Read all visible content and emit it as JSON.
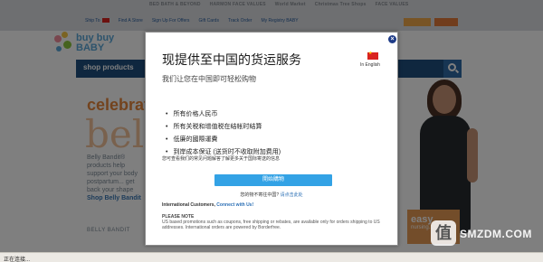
{
  "background_site": {
    "topbar_links": [
      "Ship To",
      "Find A Store",
      "Sign Up For Offers",
      "Gift Cards",
      "Track Order",
      "My Registry BABY"
    ],
    "brand_logos": [
      "BED BATH & BEYOND",
      "HARMON FACE VALUES",
      "World Market",
      "Christmas Tree Shops",
      "FACE VALUES"
    ],
    "logo": "buy buy BABY",
    "nav_label": "shop products",
    "hero_title": "celebrat",
    "hero_big": "bell",
    "hero_text": "Belly Bandit® products help support your body postpartum... get back your shape",
    "hero_link": "Shop Belly Bandit",
    "hero_brand": "BELLY BANDIT",
    "badge_big": "easy",
    "badge_small": "nursing..."
  },
  "modal": {
    "title": "现提供至中国的货运服务",
    "subtitle": "我们让您在中国即可轻松购物",
    "language": {
      "label": "In English",
      "flag_color": "#d9231f"
    },
    "benefits": [
      "所有价格人民币",
      "所有关税和增值税在结帐时结算",
      "低廉的國際運費",
      "到岸成本保证 (送货时不收取附加费用)"
    ],
    "info_line": "您可查看我们的常见问题解答了解更多关于国际寄送的信息",
    "start_button": "開始購物",
    "not_china_text": "您的物不寄往中国?",
    "not_china_link": "请点击此处",
    "intl_label": "International Customers,",
    "intl_link": "Connect with Us!",
    "note_heading": "PLEASE NOTE",
    "note_text": "US based promotions such as coupons, free shipping or rebates, are available only for orders shipping to US addresses. International orders are powered by Borderfree."
  },
  "watermark": "SMZDM.COM",
  "status_bar": "正在连接...",
  "colors": {
    "overlay": "rgba(0,0,0,0.5)",
    "nav": "#1e4f7f",
    "button": "#33a2e5",
    "link": "#2b6fb5",
    "close": "#1f3c88"
  }
}
